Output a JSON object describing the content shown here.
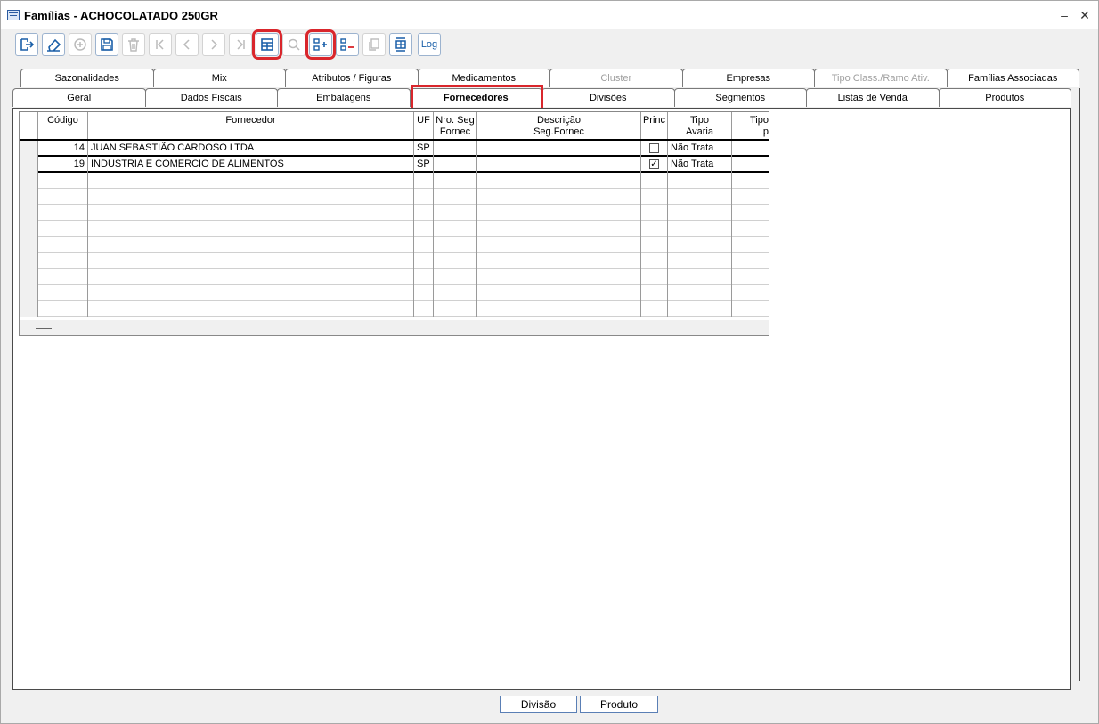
{
  "window": {
    "title": "Famílias - ACHOCOLATADO 250GR",
    "minimize": "–",
    "close": "✕"
  },
  "toolbar": {
    "log_label": "Log"
  },
  "tabs_row1": [
    "Sazonalidades",
    "Mix",
    "Atributos / Figuras",
    "Medicamentos",
    "Cluster",
    "Empresas",
    "Tipo Class./Ramo Ativ.",
    "Famílias Associadas"
  ],
  "tabs_row2": [
    "Geral",
    "Dados Fiscais",
    "Embalagens",
    "Fornecedores",
    "Divisões",
    "Segmentos",
    "Listas de Venda",
    "Produtos"
  ],
  "active_tab": "Fornecedores",
  "grid": {
    "headers": {
      "codigo": "Código",
      "fornecedor": "Fornecedor",
      "uf": "UF",
      "nro": "Nro. Seg\nFornec",
      "desc": "Descrição\nSeg.Fornec",
      "princ": "Princ",
      "tipo_avaria": "Tipo\nAvaria",
      "tipo_p": "Tipo\np"
    },
    "rows": [
      {
        "codigo": "14",
        "fornecedor": "JUAN SEBASTIÃO CARDOSO LTDA",
        "uf": "SP",
        "nro": "",
        "desc": "",
        "princ": false,
        "princ_mark": "",
        "tipo_avaria": "Não Trata"
      },
      {
        "codigo": "19",
        "fornecedor": "INDUSTRIA E COMERCIO DE ALIMENTOS",
        "uf": "SP",
        "nro": "",
        "desc": "",
        "princ": true,
        "princ_mark": "✓",
        "tipo_avaria": "Não Trata"
      }
    ]
  },
  "bottom_buttons": {
    "divisao": "Divisão",
    "produto": "Produto"
  }
}
